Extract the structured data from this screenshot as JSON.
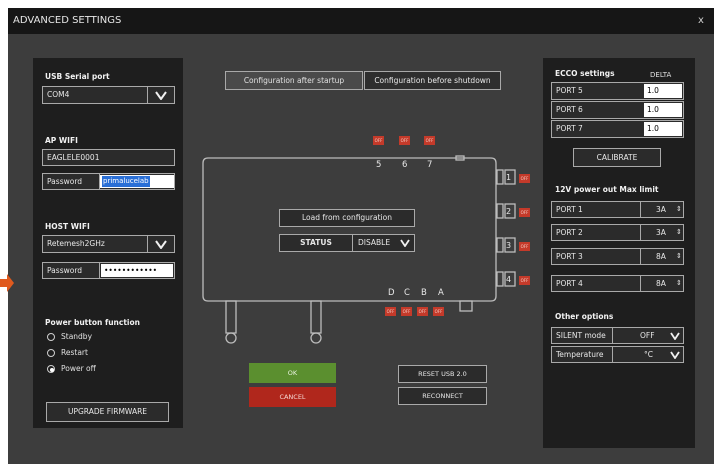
{
  "title": "ADVANCED SETTINGS",
  "close": "x",
  "left": {
    "usb_label": "USB Serial port",
    "usb_value": "COM4",
    "ap_label": "AP WIFI",
    "ap_ssid": "EAGLELE0001",
    "password_label": "Password",
    "ap_password": "primalucelab",
    "host_label": "HOST WIFI",
    "host_ssid": "Retemesh2GHz",
    "host_password": "••••••••••••",
    "power_label": "Power button function",
    "power_options": [
      "Standby",
      "Restart",
      "Power off"
    ],
    "power_selected": "Power off",
    "upgrade": "UPGRADE FIRMWARE"
  },
  "center": {
    "tab_startup": "Configuration after startup",
    "tab_shutdown": "Configuration before shutdown",
    "load_btn": "Load from configuration",
    "status_label": "STATUS",
    "status_value": "DISABLE",
    "top_ports": [
      "5",
      "6",
      "7"
    ],
    "side_ports": [
      "1",
      "2",
      "3",
      "4"
    ],
    "bottom_ports": [
      "D",
      "C",
      "B",
      "A"
    ],
    "off_tag": "OFF",
    "ok": "OK",
    "cancel": "CANCEL",
    "reset_usb": "RESET USB 2.0",
    "reconnect": "RECONNECT"
  },
  "right": {
    "ecco_label": "ECCO settings",
    "delta_label": "DELTA",
    "ecco_rows": [
      {
        "port": "PORT 5",
        "value": "1.0"
      },
      {
        "port": "PORT 6",
        "value": "1.0"
      },
      {
        "port": "PORT 7",
        "value": "1.0"
      }
    ],
    "calibrate": "CALIBRATE",
    "power_limit_label": "12V power out Max limit",
    "limit_rows": [
      {
        "port": "PORT 1",
        "value": "3A"
      },
      {
        "port": "PORT 2",
        "value": "3A"
      },
      {
        "port": "PORT 3",
        "value": "8A"
      },
      {
        "port": "PORT 4",
        "value": "8A"
      }
    ],
    "other_label": "Other options",
    "silent_label": "SILENT mode",
    "silent_value": "OFF",
    "temp_label": "Temperature",
    "temp_value": "°C"
  },
  "colors": {
    "ok": "#5b8f2f",
    "cancel": "#b0271c",
    "off_tag": "#c43a2a",
    "arrow": "#e05a1e",
    "selection": "#2a6fd6"
  }
}
